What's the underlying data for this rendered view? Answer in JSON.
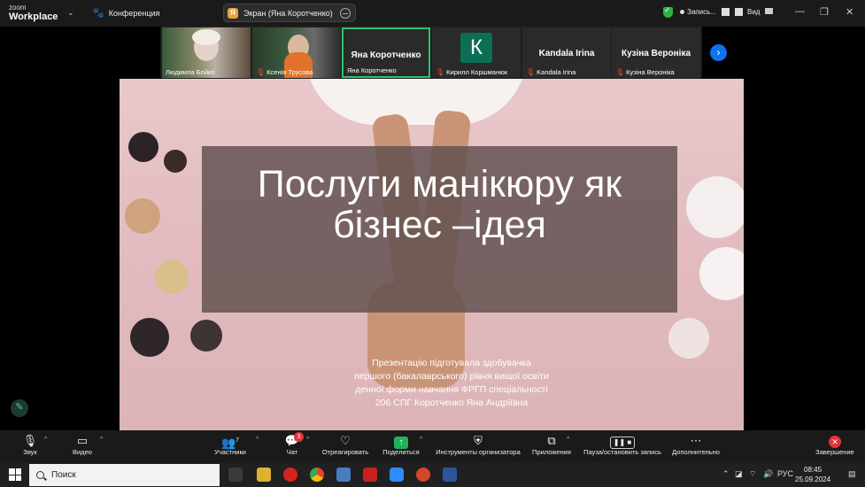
{
  "topbar": {
    "logo_line1": "zoom",
    "logo_line2": "Workplace",
    "conference_label": "Конференция",
    "screen_share_label": "Экран (Яна Коротченко)",
    "screen_share_avatar": "Я",
    "recording_label": "Запись...",
    "view_label": "Вид",
    "colors": {
      "security_green": "#2bb34a",
      "accent_blue": "#0e72ed"
    }
  },
  "participants": [
    {
      "name": "Людмила Бойко",
      "muted": false,
      "has_video": true
    },
    {
      "name": "Ксенія Трусова",
      "muted": true,
      "has_video": true
    },
    {
      "name": "Яна Коротченко",
      "display": "Яна Коротченко",
      "muted": false,
      "has_video": false,
      "active_speaker": true
    },
    {
      "name": "Кирилл Коршманюк",
      "avatar_letter": "К",
      "muted": true,
      "has_video": false
    },
    {
      "name": "Kandala Irina",
      "display": "Kandala Irina",
      "muted": true,
      "has_video": false
    },
    {
      "name": "Кузіна Вероніка",
      "display": "Кузіна Вероніка",
      "muted": true,
      "has_video": false
    }
  ],
  "slide": {
    "title": "Послуги манікюру як бізнес –ідея",
    "subtitle_lines": [
      "Презентацію підготувала здобувачка",
      "першого (бакалаврського) рівня вищої освіти",
      "денної форми навчання ФРГП спеціальності",
      "206 СПГ Коротченко Яна Андріївна"
    ]
  },
  "toolbar": {
    "audio": "Звук",
    "video": "Видео",
    "participants": "Участники",
    "participants_count": "7",
    "chat": "Чат",
    "chat_badge": "3",
    "react": "Отреагировать",
    "share": "Поделиться",
    "host_tools": "Инструменты организатора",
    "apps": "Приложения",
    "pause_stop_record": "Пауза/остановить запись",
    "more": "Дополнительно",
    "end": "Завершение",
    "colors": {
      "end_red": "#e5323b",
      "share_green": "#22b35a"
    }
  },
  "taskbar": {
    "search_placeholder": "Поиск",
    "language": "РУС",
    "time": "08:45",
    "date": "25.09.2024"
  }
}
